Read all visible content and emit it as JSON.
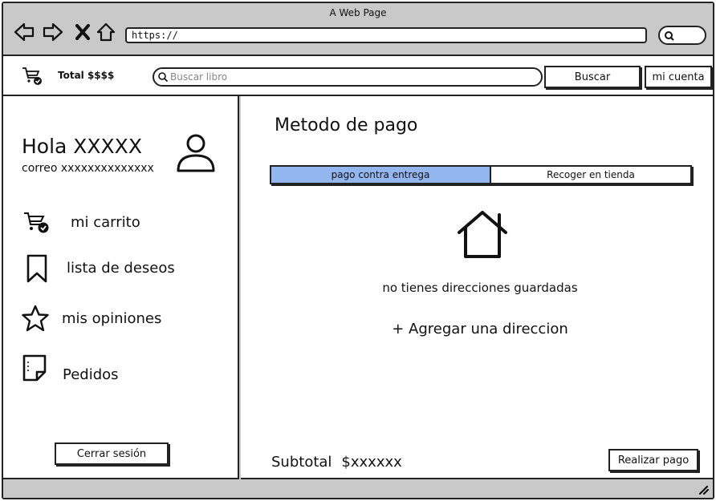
{
  "window": {
    "title": "A Web Page"
  },
  "browser": {
    "url": "https://"
  },
  "header": {
    "total_label": "Total $$$$",
    "search_placeholder": "Buscar libro",
    "search_button": "Buscar",
    "account_button": "mi cuenta"
  },
  "sidebar": {
    "greeting": "Hola XXXXX",
    "email": "correo xxxxxxxxxxxxxx",
    "items": [
      {
        "label": "mi carrito",
        "icon": "cart-check-icon"
      },
      {
        "label": "lista de deseos",
        "icon": "bookmark-icon"
      },
      {
        "label": "mis opiniones",
        "icon": "star-icon"
      },
      {
        "label": "Pedidos",
        "icon": "note-icon"
      }
    ],
    "logout_button": "Cerrar sesión"
  },
  "main": {
    "title": "Metodo de pago",
    "tabs": [
      {
        "label": "pago contra entrega",
        "active": true
      },
      {
        "label": "Recoger en tienda",
        "active": false
      }
    ],
    "empty_message": "no tienes direcciones guardadas",
    "add_address": "+ Agregar una direccion",
    "subtotal_label": "Subtotal",
    "subtotal_value": "$xxxxxx",
    "pay_button": "Realizar pago"
  },
  "colors": {
    "active_tab": "#93b6ee",
    "chrome": "#c9c9c9"
  }
}
